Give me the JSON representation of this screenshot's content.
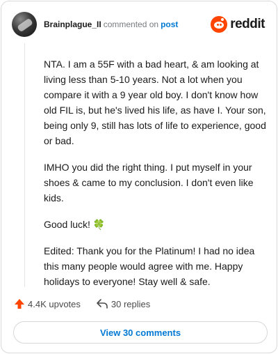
{
  "header": {
    "username": "Brainplague_II",
    "action_text": "commented on",
    "post_link": "post",
    "brand_name": "reddit"
  },
  "comment": {
    "paragraphs": [
      "NTA. I am a 55F with a bad heart, & am looking at living less than 5-10 years. Not a lot when you compare it with a 9 year old boy. I don't know how old FIL is, but he's lived his life, as have I. Your son, being only 9, still has lots of life to experience, good or bad.",
      "IMHO you did the right thing. I put myself in your shoes & came to my conclusion. I don't even like kids.",
      "Good luck! 🍀",
      "Edited: Thank you for the Platinum! I had no idea this many people would agree with me. Happy holidays to everyone! Stay well & safe."
    ]
  },
  "footer": {
    "upvotes": "4.4K upvotes",
    "replies": "30 replies",
    "view_comments": "View 30 comments"
  },
  "colors": {
    "accent_orange": "#ff4500",
    "link_blue": "#0079d3"
  }
}
